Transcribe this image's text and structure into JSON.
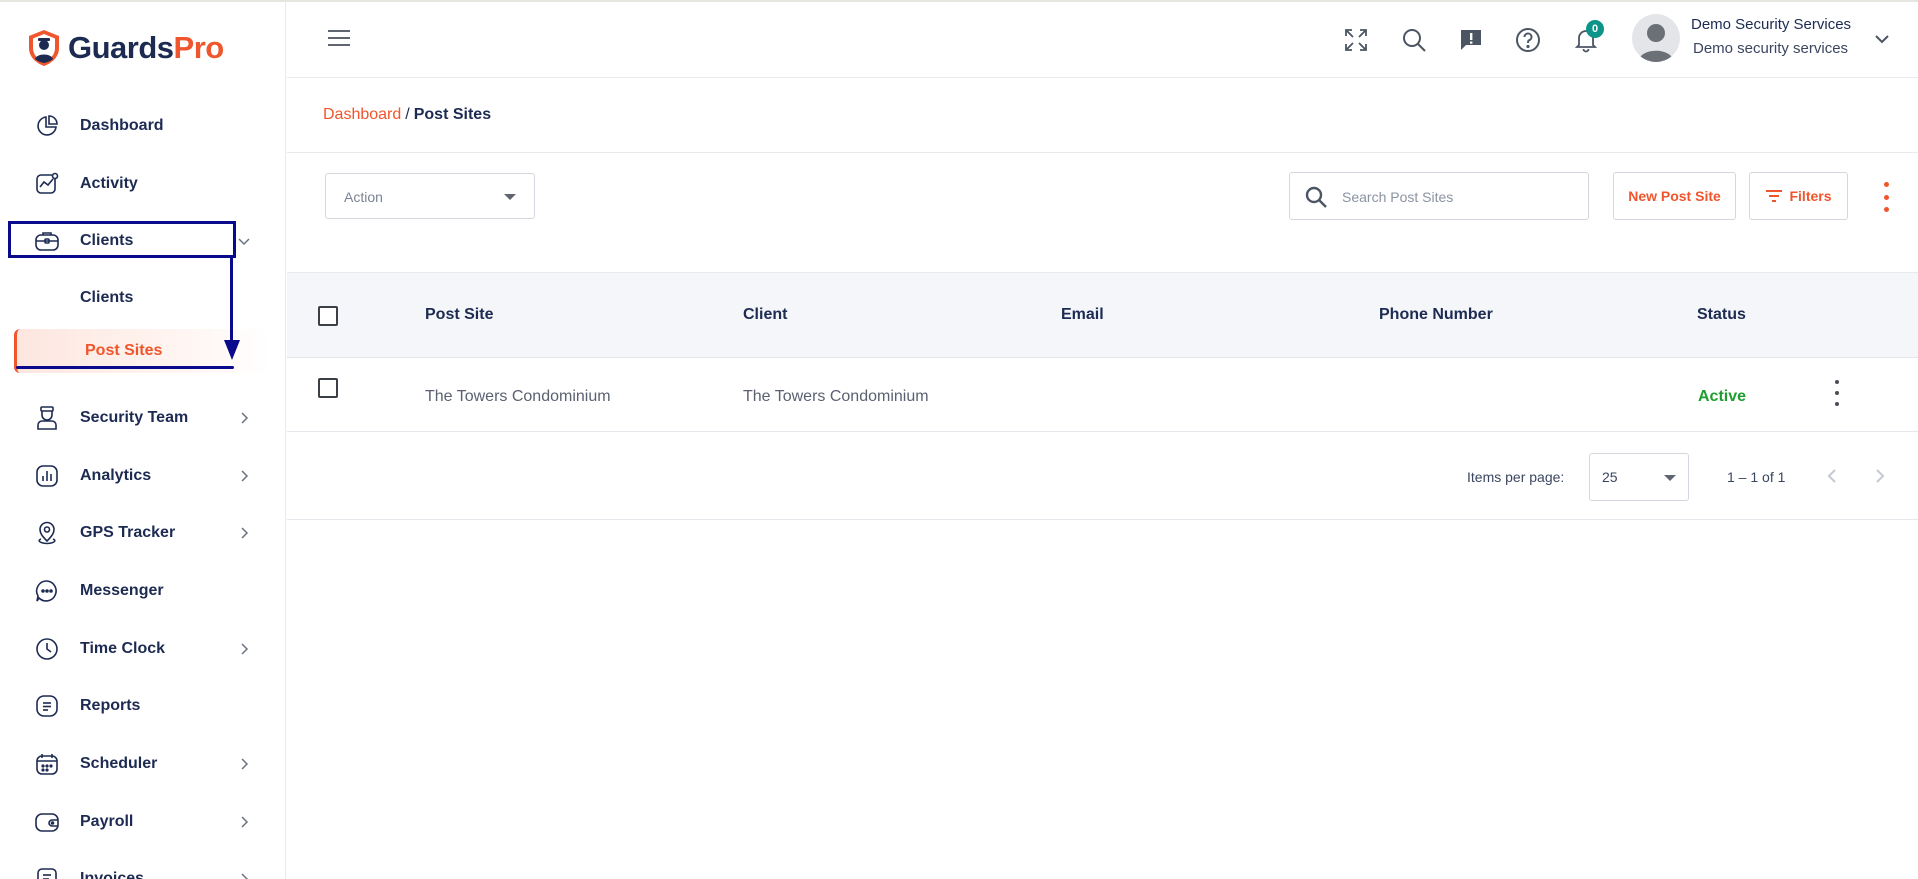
{
  "app": {
    "brand_main": "Guards",
    "brand_accent": "Pro",
    "accent_color": "#f0562d",
    "navy_color": "#1d2b52"
  },
  "sidebar": {
    "items": [
      {
        "label": "Dashboard",
        "icon": "pie-chart-icon"
      },
      {
        "label": "Activity",
        "icon": "activity-chart-icon"
      },
      {
        "label": "Clients",
        "icon": "briefcase-icon",
        "expanded": true
      },
      {
        "label": "Security Team",
        "icon": "guard-icon"
      },
      {
        "label": "Analytics",
        "icon": "analytics-icon"
      },
      {
        "label": "GPS Tracker",
        "icon": "map-pin-icon"
      },
      {
        "label": "Messenger",
        "icon": "chat-bubble-icon"
      },
      {
        "label": "Time Clock",
        "icon": "clock-icon"
      },
      {
        "label": "Reports",
        "icon": "document-icon"
      },
      {
        "label": "Scheduler",
        "icon": "calendar-icon"
      },
      {
        "label": "Payroll",
        "icon": "wallet-icon"
      },
      {
        "label": "Invoices",
        "icon": "invoice-icon"
      }
    ],
    "clients_sub": [
      {
        "label": "Clients"
      },
      {
        "label": "Post Sites",
        "active": true
      }
    ]
  },
  "header": {
    "notification_count": "0",
    "user_name": "Demo Security Services",
    "user_company": "Demo security services"
  },
  "breadcrumb": {
    "root": "Dashboard",
    "separator": "/",
    "current": "Post Sites"
  },
  "toolbar": {
    "action_placeholder": "Action",
    "search_placeholder": "Search Post Sites",
    "new_button": "New Post Site",
    "filters_button": "Filters"
  },
  "table": {
    "columns": [
      "Post Site",
      "Client",
      "Email",
      "Phone Number",
      "Status"
    ],
    "rows": [
      {
        "post_site": "The Towers Condominium",
        "client": "The Towers Condominium",
        "email": "",
        "phone": "",
        "status": "Active"
      }
    ],
    "status_active_color": "#1d9e2f"
  },
  "paginator": {
    "items_label": "Items per page:",
    "page_size": "25",
    "range": "1 – 1 of 1"
  }
}
